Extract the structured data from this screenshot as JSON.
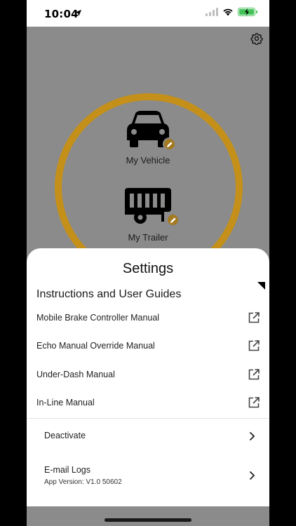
{
  "status_bar": {
    "time": "10:04",
    "icons": [
      "location-arrow-icon",
      "signal-icon",
      "wifi-icon",
      "battery-charging-icon"
    ]
  },
  "header": {
    "settings_icon": "gear-icon"
  },
  "ring_color": "#c49019",
  "vehicles": {
    "vehicle": {
      "label": "My Vehicle",
      "icon": "car-icon"
    },
    "trailer": {
      "label": "My Trailer",
      "icon": "trailer-icon"
    }
  },
  "sheet": {
    "title": "Settings",
    "section_title": "Instructions and User Guides",
    "manuals": [
      {
        "label": "Mobile Brake Controller Manual",
        "icon": "external-link-icon"
      },
      {
        "label": "Echo Manual Override Manual",
        "icon": "external-link-icon"
      },
      {
        "label": "Under-Dash Manual",
        "icon": "external-link-icon"
      },
      {
        "label": "In-Line Manual",
        "icon": "external-link-icon"
      }
    ],
    "actions": {
      "deactivate": {
        "label": "Deactivate",
        "icon": "chevron-right-icon"
      },
      "email_logs": {
        "label": "E-mail Logs",
        "subtitle": "App Version: V1.0 50602",
        "icon": "chevron-right-icon"
      }
    }
  },
  "colors": {
    "accent": "#c49019",
    "edit_badge": "#a37a22",
    "battery": "#44c257"
  }
}
